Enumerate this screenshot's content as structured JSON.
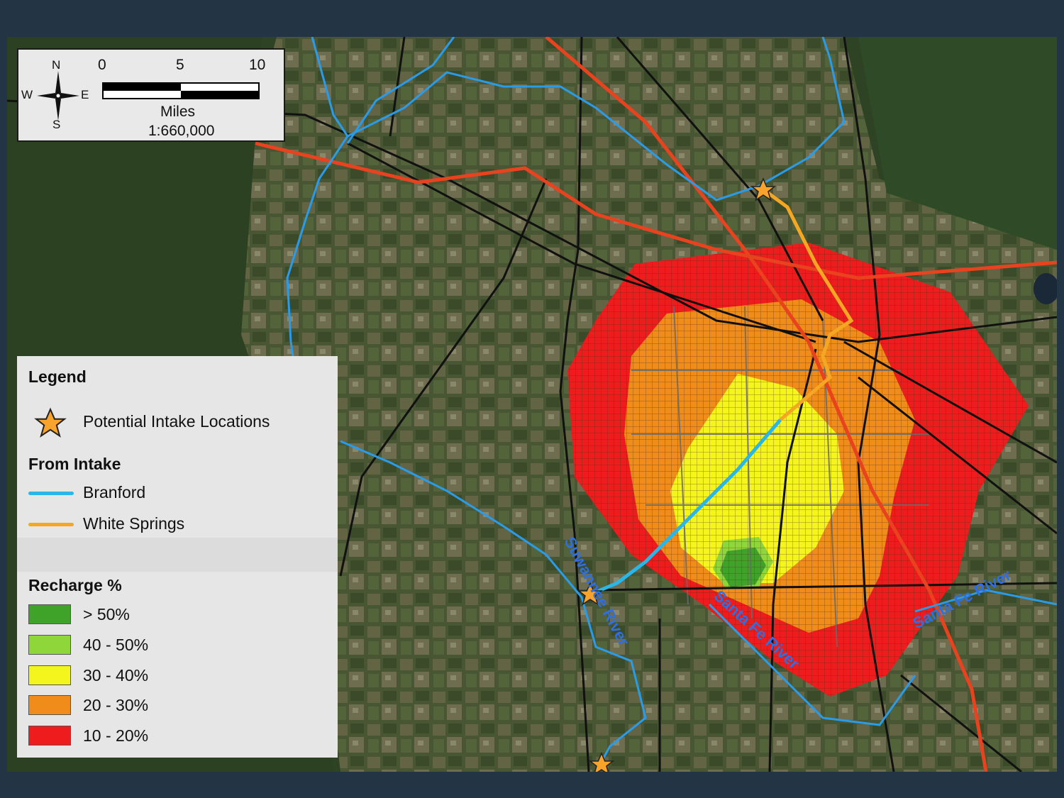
{
  "scale_box": {
    "compass": {
      "n": "N",
      "s": "S",
      "e": "E",
      "w": "W"
    },
    "ticks": [
      "0",
      "5",
      "10"
    ],
    "units": "Miles",
    "ratio": "1:660,000"
  },
  "legend": {
    "title": "Legend",
    "intake_label": "Potential Intake Locations",
    "from_intake_title": "From Intake",
    "routes": [
      {
        "label": "Branford",
        "color": "#29b6e8"
      },
      {
        "label": "White Springs",
        "color": "#f5a623"
      }
    ],
    "recharge_title": "Recharge %",
    "recharge_classes": [
      {
        "label": "> 50%",
        "color": "#3fa32a"
      },
      {
        "label": "40 - 50%",
        "color": "#8fd63a"
      },
      {
        "label": "30 - 40%",
        "color": "#f5f51e"
      },
      {
        "label": "20 - 30%",
        "color": "#f08c1a"
      },
      {
        "label": "10 - 20%",
        "color": "#ee1c1c"
      }
    ]
  },
  "map_labels": {
    "suwannee": "Suwannee River",
    "santa_fe_1": "Santa Fe River",
    "santa_fe_2": "Santa Fe River"
  },
  "colors": {
    "river": "#2a9be8",
    "highway": "#e8421e",
    "road": "#111111",
    "star": "#f7a32c",
    "background_vegetation": "#2f4424"
  }
}
